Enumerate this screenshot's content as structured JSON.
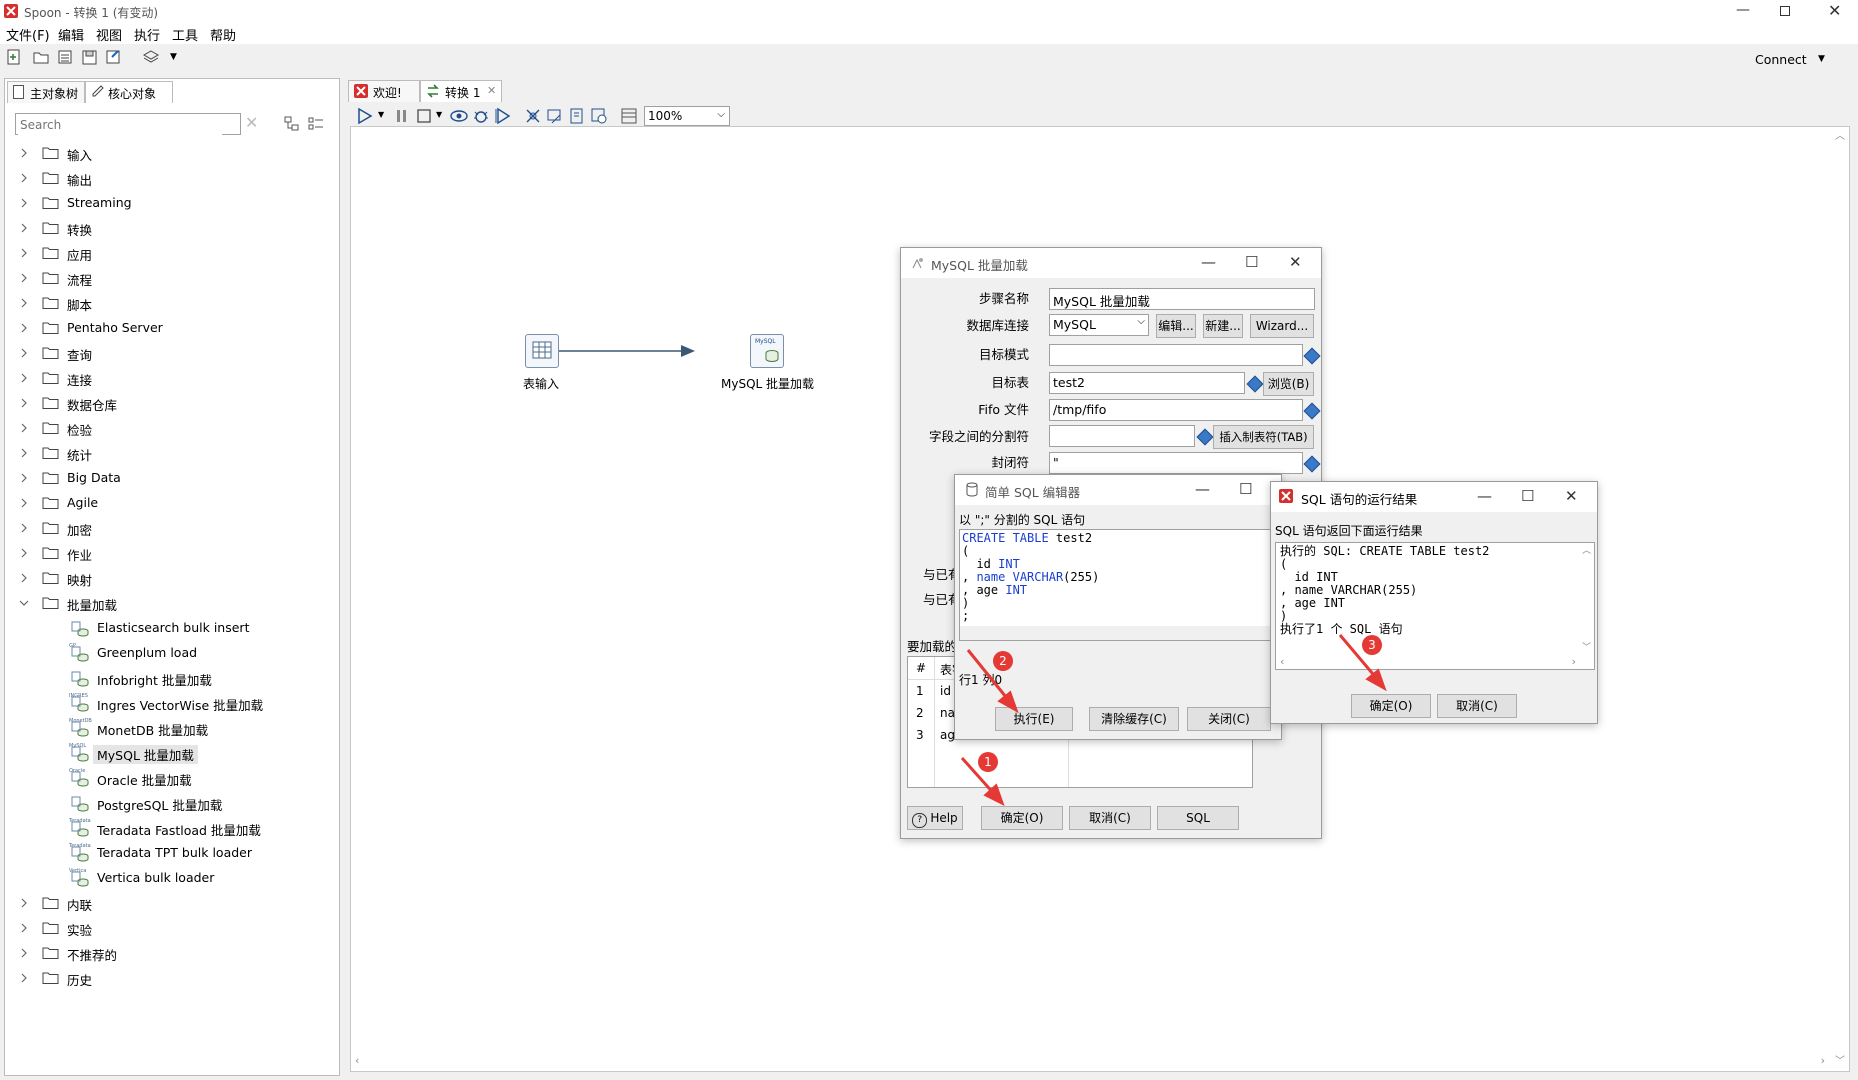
{
  "app": {
    "title": "Spoon - 转换 1 (有变动)"
  },
  "menu": [
    "文件(F)",
    "编辑",
    "视图",
    "执行",
    "工具",
    "帮助"
  ],
  "toolbar": {
    "connect_label": "Connect"
  },
  "left_panel": {
    "tabs": [
      "主对象树",
      "核心对象"
    ],
    "search_placeholder": "Search",
    "folders_top": [
      "输入",
      "输出",
      "Streaming",
      "转换",
      "应用",
      "流程",
      "脚本",
      "Pentaho Server",
      "查询",
      "连接",
      "数据仓库",
      "检验",
      "统计",
      "Big Data",
      "Agile",
      "加密",
      "作业",
      "映射"
    ],
    "expanded_folder": "批量加载",
    "bulk_steps": [
      {
        "label": "Elasticsearch bulk insert",
        "icon": "elasticsearch-icon",
        "badge": ""
      },
      {
        "label": "Greenplum load",
        "icon": "greenplum-icon",
        "badge": "GP"
      },
      {
        "label": "Infobright 批量加载",
        "icon": "infobright-icon",
        "badge": ""
      },
      {
        "label": "Ingres VectorWise 批量加载",
        "icon": "ingres-icon",
        "badge": "INGRES"
      },
      {
        "label": "MonetDB 批量加载",
        "icon": "monetdb-icon",
        "badge": "MonetDB"
      },
      {
        "label": "MySQL 批量加载",
        "icon": "mysql-icon",
        "badge": "MySQL"
      },
      {
        "label": "Oracle 批量加载",
        "icon": "oracle-icon",
        "badge": "Oracle"
      },
      {
        "label": "PostgreSQL 批量加载",
        "icon": "postgresql-icon",
        "badge": ""
      },
      {
        "label": "Teradata Fastload 批量加载",
        "icon": "teradata-icon",
        "badge": "Teradata"
      },
      {
        "label": "Teradata TPT bulk loader",
        "icon": "teradata-tpt-icon",
        "badge": "Teradata"
      },
      {
        "label": "Vertica bulk loader",
        "icon": "vertica-icon",
        "badge": "Vertica"
      }
    ],
    "folders_bottom": [
      "内联",
      "实验",
      "不推荐的",
      "历史"
    ]
  },
  "editor": {
    "tabs": [
      "欢迎!",
      "转换 1"
    ],
    "zoom": "100%"
  },
  "canvas": {
    "step1_label": "表输入",
    "step2_label": "MySQL 批量加载",
    "step2_badge": "MySQL"
  },
  "mysql_dialog": {
    "title": "MySQL 批量加载",
    "step_name_label": "步骤名称",
    "step_name_value": "MySQL 批量加载",
    "db_conn_label": "数据库连接",
    "db_conn_value": "MySQL",
    "edit_btn": "编辑...",
    "new_btn": "新建...",
    "wizard_btn": "Wizard...",
    "target_schema_label": "目标模式",
    "target_table_label": "目标表",
    "target_table_value": "test2",
    "browse_btn": "浏览(B)",
    "fifo_label": "Fifo 文件",
    "fifo_value": "/tmp/fifo",
    "delim_label": "字段之间的分割符",
    "insert_tab_btn": "插入制表符(TAB)",
    "enclosure_label": "封闭符",
    "enclosure_value": "\"",
    "partial_label_a": "与已有",
    "partial_label_b": "与已有",
    "fields_label": "要加载的",
    "table_header": [
      "#",
      "表字"
    ],
    "rows": [
      {
        "n": "1",
        "v": "id"
      },
      {
        "n": "2",
        "v": "na"
      },
      {
        "n": "3",
        "v": "ag"
      }
    ],
    "help_btn": "Help",
    "ok_btn": "确定(O)",
    "cancel_btn": "取消(C)",
    "sql_btn": "SQL"
  },
  "sql_editor": {
    "title": "简单 SQL 编辑器",
    "hint": "以 \";\" 分割的 SQL 语句",
    "code": [
      [
        {
          "t": "CREATE TABLE",
          "k": true
        },
        {
          "t": " test2",
          "k": false
        }
      ],
      [
        {
          "t": "(",
          "k": false
        }
      ],
      [
        {
          "t": "  id ",
          "k": false
        },
        {
          "t": "INT",
          "k": true
        }
      ],
      [
        {
          "t": ", ",
          "k": false
        },
        {
          "t": "name",
          "k": true
        },
        {
          "t": " ",
          "k": false
        },
        {
          "t": "VARCHAR",
          "k": true
        },
        {
          "t": "(255)",
          "k": false
        }
      ],
      [
        {
          "t": ", age ",
          "k": false
        },
        {
          "t": "INT",
          "k": true
        }
      ],
      [
        {
          "t": ")",
          "k": false
        }
      ],
      [
        {
          "t": ";",
          "k": false
        }
      ]
    ],
    "status": "行1 列0",
    "exec_btn": "执行(E)",
    "clear_btn": "清除缓存(C)",
    "close_btn": "关闭(C)"
  },
  "result_dialog": {
    "title": "SQL 语句的运行结果",
    "header": "SQL 语句返回下面运行结果",
    "lines": [
      "执行的 SQL: CREATE TABLE test2",
      "(",
      "  id INT",
      ", name VARCHAR(255)",
      ", age INT",
      ")",
      "执行了1 个 SQL 语句"
    ],
    "ok_btn": "确定(O)",
    "cancel_btn": "取消(C)"
  },
  "annotations": [
    "1",
    "2",
    "3"
  ],
  "colors": {
    "accent": "#3a79c8",
    "annotation": "#e53935",
    "keyword": "#1a3fcf"
  }
}
